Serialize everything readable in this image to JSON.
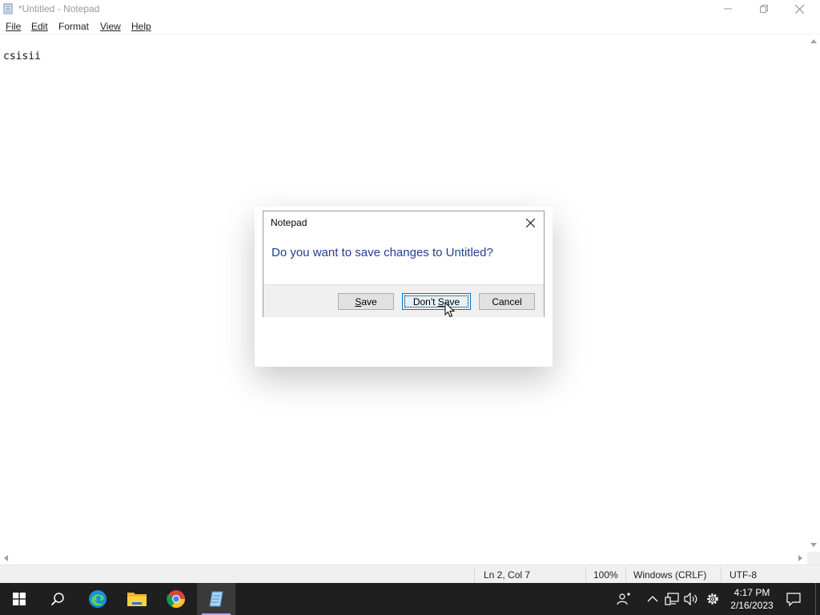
{
  "window": {
    "title": "*Untitled - Notepad"
  },
  "menu": {
    "file": "File",
    "edit": "Edit",
    "format": "Format",
    "view": "View",
    "help": "Help"
  },
  "editor": {
    "content": "csisii"
  },
  "status": {
    "position": "Ln 2, Col 7",
    "zoom": "100%",
    "line_endings": "Windows (CRLF)",
    "encoding": "UTF-8"
  },
  "dialog": {
    "title": "Notepad",
    "message": "Do you want to save changes to Untitled?",
    "save_prefix": "",
    "save_mnemonic": "S",
    "save_rest": "ave",
    "dontsave_prefix": "Don't ",
    "dontsave_mnemonic": "S",
    "dontsave_rest": "ave",
    "cancel_label": "Cancel"
  },
  "taskbar": {
    "time": "4:17 PM",
    "date": "2/16/2023",
    "apps": [
      "start-icon",
      "search-icon",
      "edge-icon",
      "file-explorer-icon",
      "chrome-icon",
      "notepad-icon"
    ]
  },
  "colors": {
    "dialog_message": "#1f3f93",
    "taskbar_bg": "#1f1f1f",
    "focus_border": "#0078d7"
  }
}
